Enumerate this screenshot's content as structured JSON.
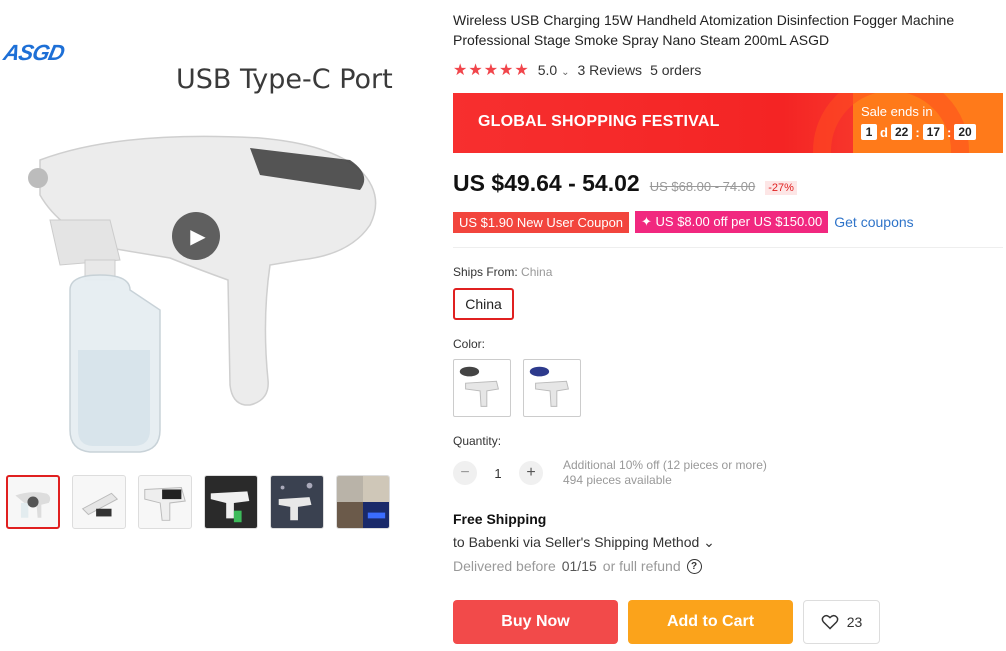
{
  "gallery": {
    "brand_logo": "ASGD",
    "caption": "USB Type-C Port",
    "play_icon": "play-icon",
    "thumbnail_count": 6
  },
  "product": {
    "title": "Wireless USB Charging 15W Handheld Atomization Disinfection Fogger Machine Professional Stage Smoke Spray Nano Steam 200mL ASGD",
    "rating": "5.0",
    "rating_caret": "⌄",
    "reviews": "3 Reviews",
    "orders": "5 orders"
  },
  "banner": {
    "title": "GLOBAL SHOPPING FESTIVAL",
    "sale_ends": "Sale ends in",
    "days": "1",
    "days_unit": "d",
    "hours": "22",
    "minutes": "17",
    "seconds": "20",
    "sep": ":"
  },
  "price": {
    "current": "US $49.64 - 54.02",
    "original": "US $68.00 - 74.00",
    "discount": "-27%"
  },
  "coupons": {
    "new_user": "US $1.90 New User Coupon",
    "store": "✦ US $8.00 off per US $150.00",
    "get_link": "Get coupons"
  },
  "ships_from": {
    "label": "Ships From:",
    "value_label": "China",
    "option": "China"
  },
  "color": {
    "label": "Color:"
  },
  "quantity": {
    "label": "Quantity:",
    "minus": "−",
    "plus": "+",
    "value": "1",
    "discount_note": "Additional 10% off (12 pieces or more)",
    "available": "494 pieces available"
  },
  "shipping": {
    "title": "Free Shipping",
    "method": "to Babenki via Seller's Shipping Method ⌄",
    "delivered_prefix": "Delivered before",
    "delivered_date": "01/15",
    "delivered_suffix": "or full refund",
    "help_icon": "?"
  },
  "actions": {
    "buy": "Buy Now",
    "cart": "Add to Cart",
    "wishlist_count": "23"
  },
  "colors": {
    "accent_red": "#f24a4a",
    "accent_orange": "#fba31b",
    "link_blue": "#2f74c9"
  }
}
